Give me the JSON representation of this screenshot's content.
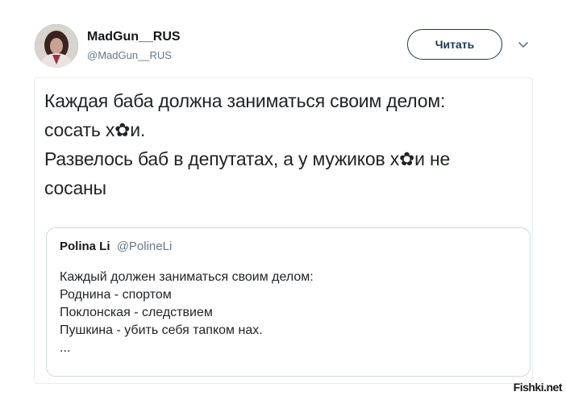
{
  "author": {
    "display_name": "MadGun__RUS",
    "handle": "@MadGun__RUS",
    "avatar_icon": "avatar-photo"
  },
  "follow_button_label": "Читать",
  "menu_icon": "chevron-down-icon",
  "tweet": {
    "lines": [
      "Каждая баба должна заниматься своим делом:",
      "сосать х✿и.",
      "Развелось баб в депутатах, а у мужиков х✿и не",
      "сосаны"
    ]
  },
  "quote": {
    "author_name": "Polina Li",
    "author_handle": "@PolineLi",
    "lines": [
      "Каждый должен заниматься своим делом:",
      "Роднина - спортом",
      "Поклонская - следствием",
      "Пушкина - убить себя тапком нах.",
      "..."
    ]
  },
  "watermark": "Fishki.net",
  "colors": {
    "accent": "#1b3a52",
    "muted": "#657786",
    "border": "#e6ecf0"
  }
}
